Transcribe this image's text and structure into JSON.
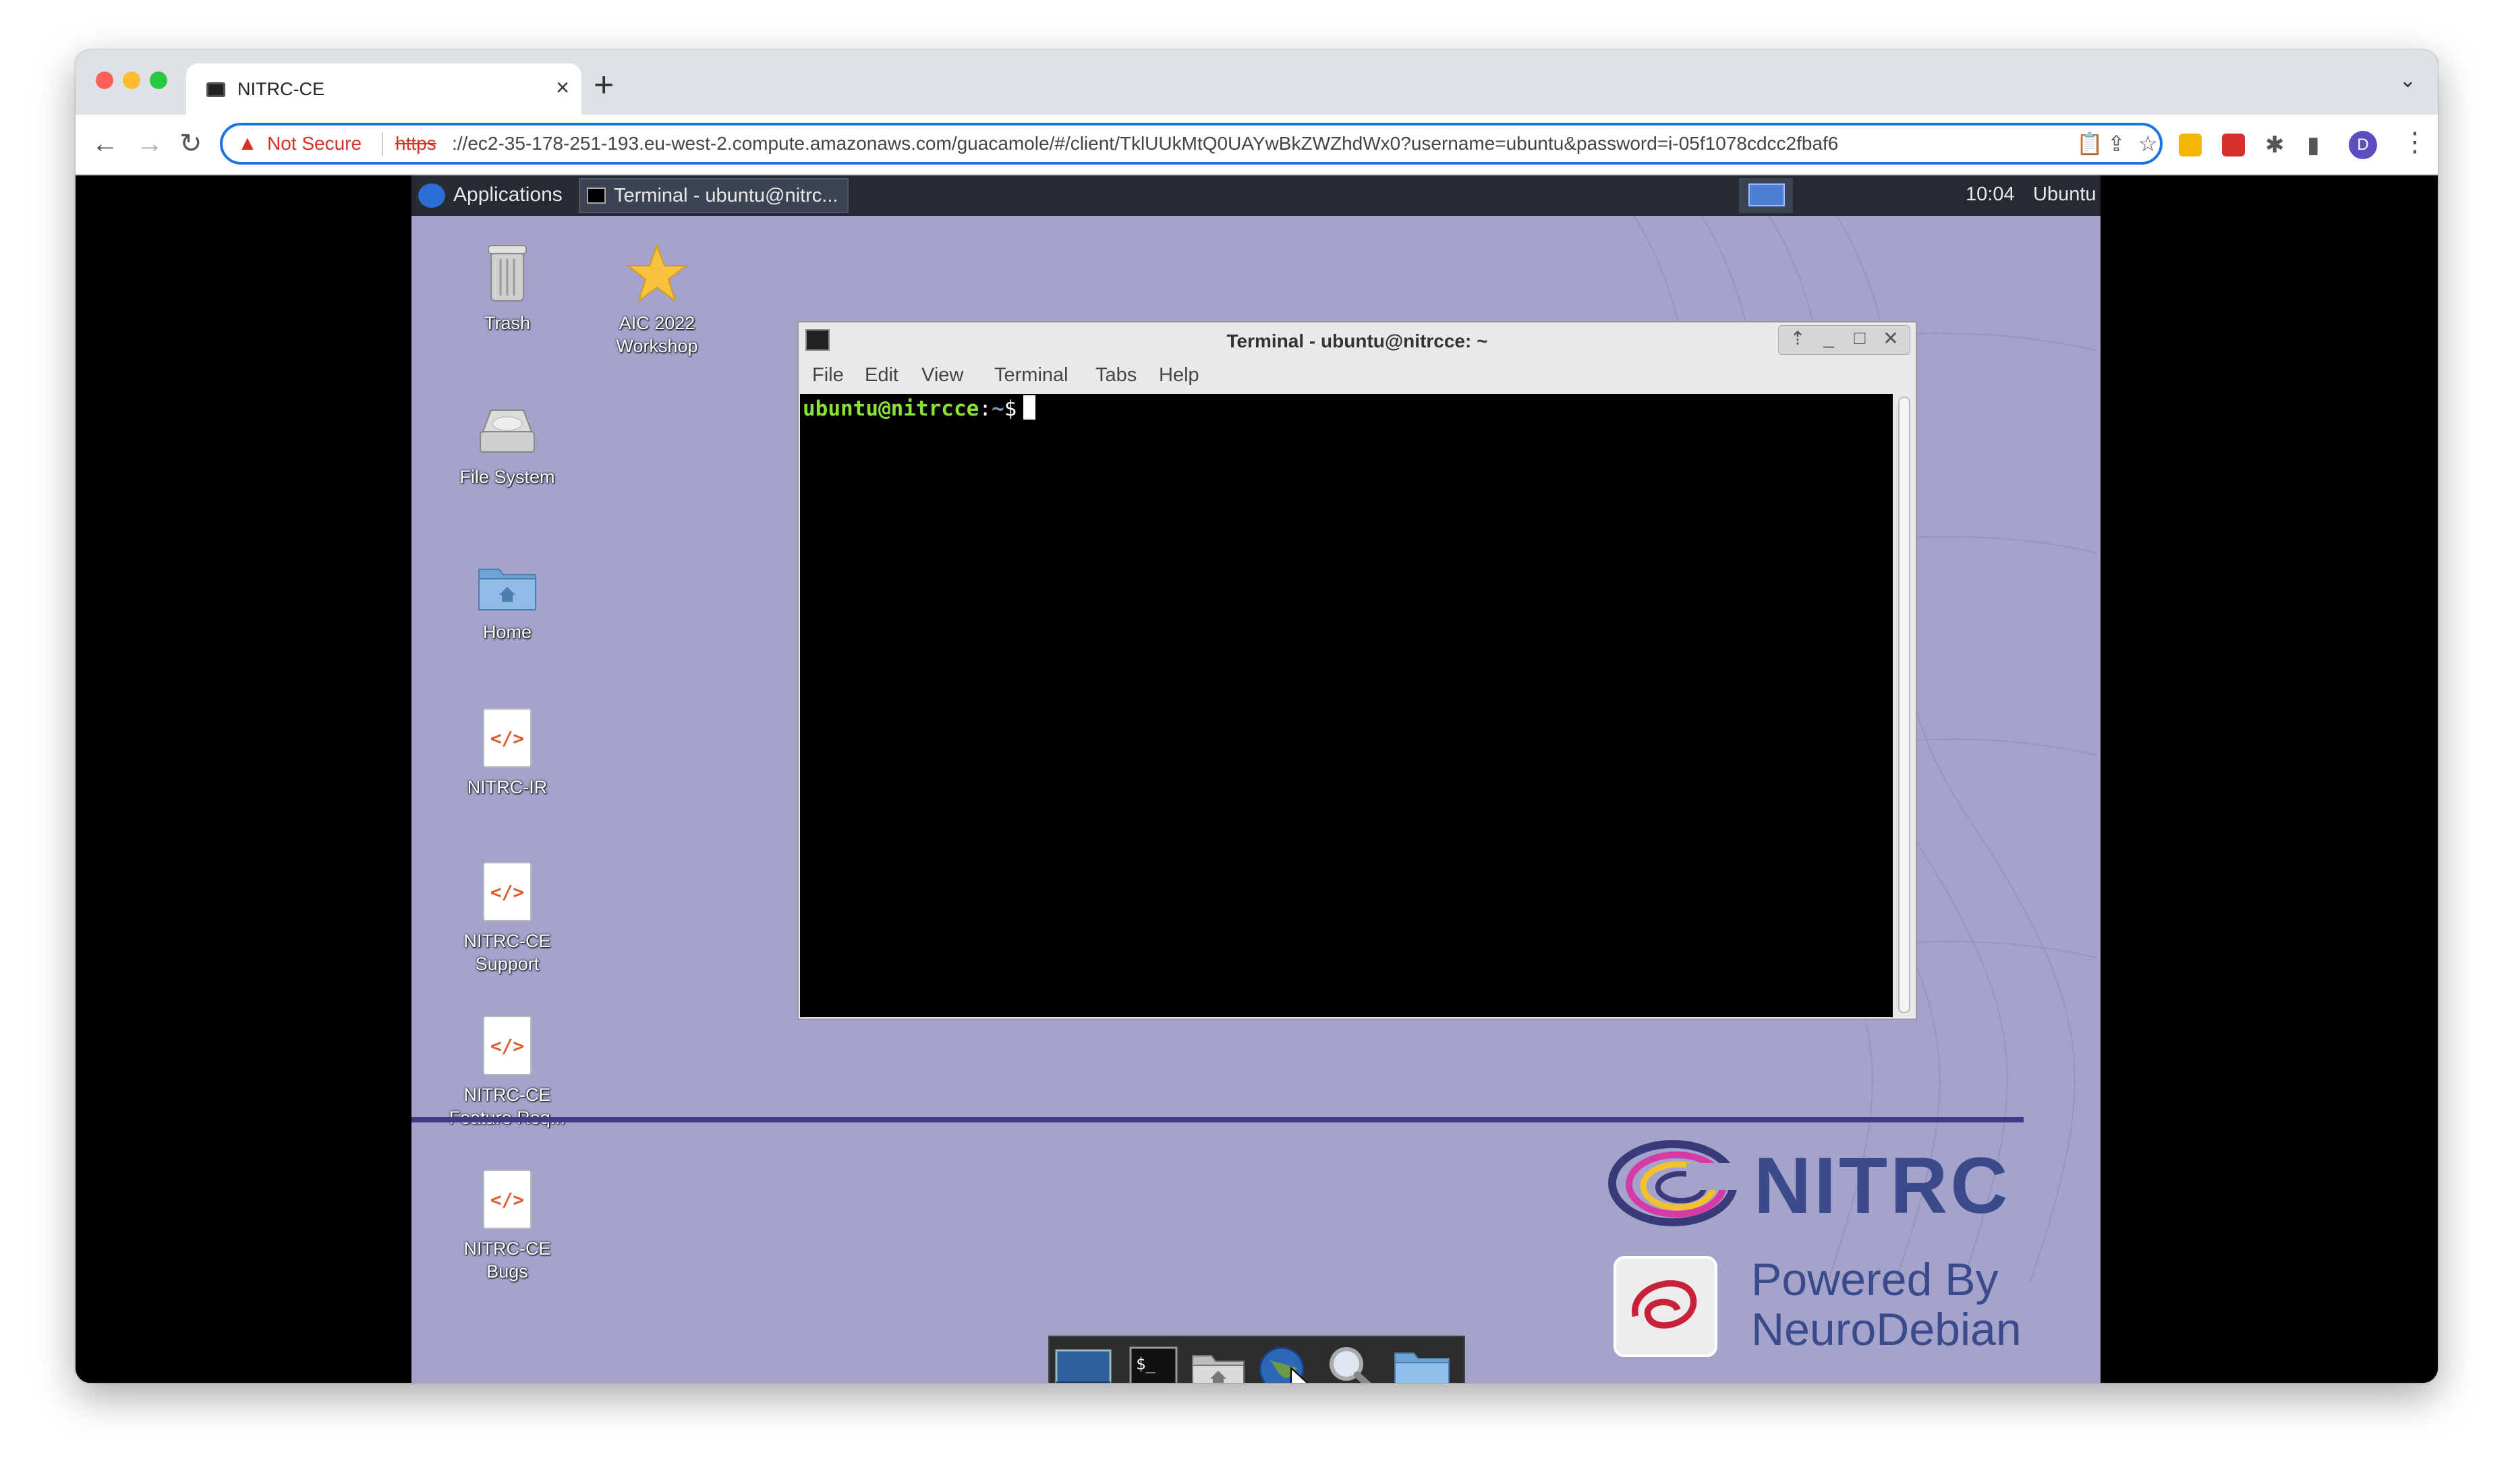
{
  "browser": {
    "tab_title": "NITRC-CE",
    "tab_close": "×",
    "new_tab": "+",
    "url_warning": "Not Secure",
    "url_scheme": "https",
    "url_rest": "://ec2-35-178-251-193.eu-west-2.compute.amazonaws.com/guacamole/#/client/TklUUkMtQ0UAYwBkZWZhdWx0?username=ubuntu&password=i-05f1078cdcc2fbaf6",
    "profile_initial": "D",
    "colors": {
      "omnibox_border": "#1a73e8",
      "not_secure": "#d93025"
    }
  },
  "panel": {
    "apps_label": "Applications",
    "task_label": "Terminal - ubuntu@nitrc...",
    "clock": "10:04",
    "user": "Ubuntu"
  },
  "desktop_icons": {
    "trash": "Trash",
    "workshop_1": "AIC 2022",
    "workshop_2": "Workshop",
    "filesystem": "File System",
    "home": "Home",
    "nitrc_ir": "NITRC-IR",
    "support_1": "NITRC-CE",
    "support_2": "Support",
    "feature_1": "NITRC-CE",
    "feature_2": "Feature Req...",
    "bugs_1": "NITRC-CE",
    "bugs_2": "Bugs",
    "code_glyph": "</>"
  },
  "terminal": {
    "title": "Terminal - ubuntu@nitrcce: ~",
    "menu": [
      "File",
      "Edit",
      "View",
      "Terminal",
      "Tabs",
      "Help"
    ],
    "prompt_user": "ubuntu@nitrcce",
    "prompt_sep": ":",
    "prompt_path": "~",
    "prompt_symbol": "$"
  },
  "branding": {
    "nitrc": "NITRC",
    "powered_1": "Powered By",
    "powered_2": "NeuroDebian"
  }
}
